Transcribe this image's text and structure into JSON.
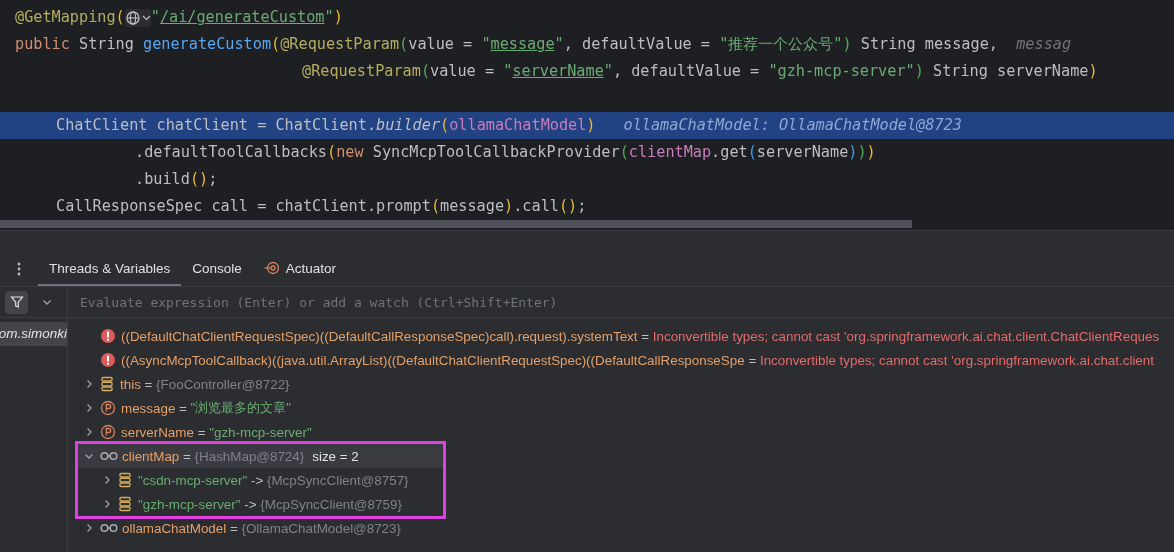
{
  "editor": {
    "lines": [
      {
        "kind": "declaration",
        "selected": false,
        "tokens": [
          {
            "kind": "annotation",
            "text": "@GetMapping"
          },
          {
            "kind": "brace_a",
            "text": "("
          },
          {
            "kind": "inlay"
          },
          {
            "kind": "string",
            "text": "\""
          },
          {
            "kind": "link",
            "text": "/ai/generateCustom"
          },
          {
            "kind": "string",
            "text": "\""
          },
          {
            "kind": "brace_a",
            "text": ")"
          }
        ]
      },
      {
        "kind": "declaration",
        "selected": false,
        "tokens": [
          {
            "kind": "keyword",
            "text": "public "
          },
          {
            "kind": "plain",
            "text": "String "
          },
          {
            "kind": "method",
            "text": "generateCustom"
          },
          {
            "kind": "brace_a",
            "text": "("
          },
          {
            "kind": "annotation",
            "text": "@RequestParam"
          },
          {
            "kind": "brace_b",
            "text": "("
          },
          {
            "kind": "plain",
            "text": "value = "
          },
          {
            "kind": "string",
            "text": "\""
          },
          {
            "kind": "link",
            "text": "message"
          },
          {
            "kind": "string",
            "text": "\""
          },
          {
            "kind": "plain",
            "text": ", defaultValue = "
          },
          {
            "kind": "string",
            "text": "\"推荐一个公众号\""
          },
          {
            "kind": "brace_b",
            "text": ")"
          },
          {
            "kind": "plain",
            "text": " String message,  "
          },
          {
            "kind": "hint",
            "text": "messag"
          }
        ]
      },
      {
        "kind": "continuation",
        "selected": false,
        "tokens": [
          {
            "kind": "annotation",
            "text": "@RequestParam"
          },
          {
            "kind": "brace_b",
            "text": "("
          },
          {
            "kind": "plain",
            "text": "value = "
          },
          {
            "kind": "string",
            "text": "\""
          },
          {
            "kind": "link",
            "text": "serverName"
          },
          {
            "kind": "string",
            "text": "\""
          },
          {
            "kind": "plain",
            "text": ", defaultValue = "
          },
          {
            "kind": "string",
            "text": "\"gzh-mcp-server\""
          },
          {
            "kind": "brace_b",
            "text": ")"
          },
          {
            "kind": "plain",
            "text": " String serverName"
          },
          {
            "kind": "brace_a",
            "text": ")"
          }
        ]
      },
      {
        "kind": "blank",
        "selected": false
      },
      {
        "kind": "statement",
        "selected": true,
        "tokens": [
          {
            "kind": "plain",
            "text": "ChatClient chatClient = ChatClient."
          },
          {
            "kind": "static",
            "text": "builder"
          },
          {
            "kind": "brace_a",
            "text": "("
          },
          {
            "kind": "field",
            "text": "ollamaChatModel"
          },
          {
            "kind": "brace_a",
            "text": ")"
          },
          {
            "kind": "debug",
            "text": "ollamaChatModel: OllamaChatModel@8723"
          }
        ]
      },
      {
        "kind": "chained",
        "selected": false,
        "tokens": [
          {
            "kind": "plain",
            "text": ".defaultToolCallbacks"
          },
          {
            "kind": "brace_a",
            "text": "("
          },
          {
            "kind": "keyword",
            "text": "new "
          },
          {
            "kind": "plain",
            "text": "SyncMcpToolCallbackProvider"
          },
          {
            "kind": "brace_b",
            "text": "("
          },
          {
            "kind": "field",
            "text": "clientMap"
          },
          {
            "kind": "plain",
            "text": ".get"
          },
          {
            "kind": "brace_c",
            "text": "("
          },
          {
            "kind": "plain",
            "text": "serverName"
          },
          {
            "kind": "brace_c",
            "text": ")"
          },
          {
            "kind": "brace_b",
            "text": ")"
          },
          {
            "kind": "brace_a",
            "text": ")"
          }
        ]
      },
      {
        "kind": "chained",
        "selected": false,
        "tokens": [
          {
            "kind": "plain",
            "text": ".build"
          },
          {
            "kind": "brace_a",
            "text": "()"
          },
          {
            "kind": "plain",
            "text": ";"
          }
        ]
      },
      {
        "kind": "statement",
        "selected": false,
        "tokens": [
          {
            "kind": "plain",
            "text": "CallResponseSpec call = chatClient.prompt"
          },
          {
            "kind": "brace_a",
            "text": "("
          },
          {
            "kind": "plain",
            "text": "message"
          },
          {
            "kind": "brace_a",
            "text": ")"
          },
          {
            "kind": "plain",
            "text": ".call"
          },
          {
            "kind": "brace_a",
            "text": "()"
          },
          {
            "kind": "plain",
            "text": ";"
          }
        ]
      }
    ]
  },
  "debugger": {
    "tabs": [
      {
        "label": "Threads & Variables",
        "selected": true,
        "icon": false
      },
      {
        "label": "Console",
        "selected": false,
        "icon": false
      },
      {
        "label": "Actuator",
        "selected": false,
        "icon": true
      }
    ],
    "evaluate": {
      "placeholder": "Evaluate expression (Enter) or add a watch (Ctrl+Shift+Enter)"
    },
    "frames": [
      {
        "label": "om.simonki",
        "selected": true
      }
    ],
    "variables": [
      {
        "kind": "error",
        "name": "((DefaultChatClientRequestSpec)((DefaultCallResponseSpec)call).request).systemText",
        "separator": " = ",
        "value": "Inconvertible types; cannot cast 'org.springframework.ai.chat.client.ChatClientReques",
        "selected": false
      },
      {
        "kind": "error",
        "name": "((AsyncMcpToolCallback)((java.util.ArrayList)((DefaultChatClientRequestSpec)((DefaultCallResponseSpe",
        "separator": " = ",
        "value": "Inconvertible types; cannot cast 'org.springframework.ai.chat.client",
        "selected": false
      },
      {
        "kind": "object",
        "name": "this",
        "separator": " = ",
        "value": "{FooController@8722}",
        "expanded": false,
        "selected": false
      },
      {
        "kind": "param",
        "name": "message",
        "separator": " = ",
        "value": "\"浏览最多的文章\"",
        "expanded": false,
        "selected": false
      },
      {
        "kind": "param",
        "name": "serverName",
        "separator": " = ",
        "value": "\"gzh-mcp-server\"",
        "expanded": false,
        "selected": false
      },
      {
        "kind": "watch",
        "name": "clientMap",
        "separator": " = ",
        "value": "{HashMap@8724}",
        "extra": "size = 2",
        "expanded": true,
        "selected": true,
        "outlined": true,
        "children": [
          {
            "kind": "entry",
            "name": "\"csdn-mcp-server\"",
            "separator": " -> ",
            "value": "{McpSyncClient@8757}",
            "expanded": false,
            "selected": false
          },
          {
            "kind": "entry",
            "name": "\"gzh-mcp-server\"",
            "separator": " -> ",
            "value": "{McpSyncClient@8759}",
            "expanded": false,
            "selected": false
          }
        ]
      },
      {
        "kind": "watch",
        "name": "ollamaChatModel",
        "separator": " = ",
        "value": "{OllamaChatModel@8723}",
        "expanded": false,
        "selected": false
      }
    ]
  }
}
